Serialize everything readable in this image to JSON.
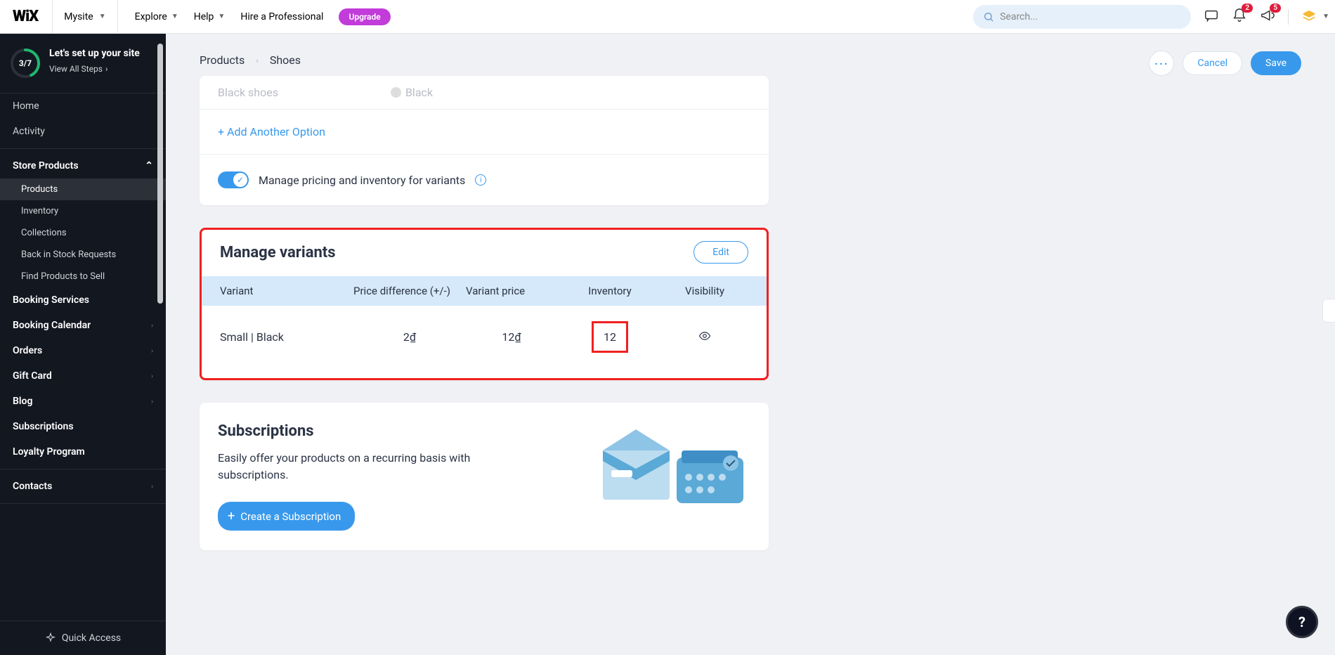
{
  "topbar": {
    "logo": "WiX",
    "site_name": "Mysite",
    "nav": {
      "explore": "Explore",
      "help": "Help",
      "hire": "Hire a Professional"
    },
    "upgrade": "Upgrade",
    "search_placeholder": "Search...",
    "badge_bell": "2",
    "badge_ann": "5"
  },
  "setup": {
    "progress": "3/7",
    "title": "Let's set up your site",
    "link": "View All Steps"
  },
  "sidebar": {
    "home": "Home",
    "activity": "Activity",
    "store_products": "Store Products",
    "sub": {
      "products": "Products",
      "inventory": "Inventory",
      "collections": "Collections",
      "back_in_stock": "Back in Stock Requests",
      "find_products": "Find Products to Sell"
    },
    "booking_services": "Booking Services",
    "booking_calendar": "Booking Calendar",
    "orders": "Orders",
    "gift_card": "Gift Card",
    "blog": "Blog",
    "subscriptions": "Subscriptions",
    "loyalty": "Loyalty Program",
    "contacts": "Contacts",
    "quick": "Quick Access"
  },
  "crumbs": {
    "root": "Products",
    "leaf": "Shoes"
  },
  "actions": {
    "cancel": "Cancel",
    "save": "Save"
  },
  "options": {
    "preview_name": "Black shoes",
    "preview_value": "Black",
    "add_another": "+  Add Another Option",
    "toggle_label": "Manage pricing and inventory for variants"
  },
  "variants": {
    "title": "Manage variants",
    "edit": "Edit",
    "cols": {
      "variant": "Variant",
      "price_diff": "Price difference (+/-)",
      "variant_price": "Variant price",
      "inventory": "Inventory",
      "visibility": "Visibility"
    },
    "row": {
      "name": "Small | Black",
      "price_diff": "2₫",
      "price": "12₫",
      "inventory": "12"
    }
  },
  "subscriptions": {
    "title": "Subscriptions",
    "desc": "Easily offer your products on a recurring basis with subscriptions.",
    "create": "Create a Subscription"
  },
  "help": "?"
}
